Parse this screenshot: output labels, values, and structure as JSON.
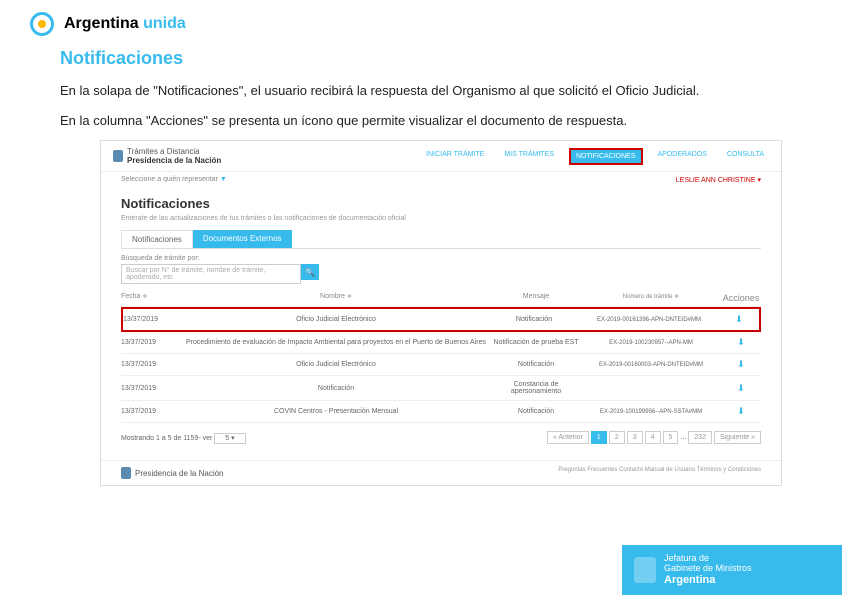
{
  "header": {
    "brand": "Argentina",
    "brand_suffix": "unida"
  },
  "section": {
    "title": "Notificaciones",
    "desc1": "En la solapa de \"Notificaciones\", el usuario recibirá la respuesta del Organismo al que solicitó el Oficio Judicial.",
    "desc2": "En la columna \"Acciones\" se presenta un ícono que permite visualizar el documento de respuesta."
  },
  "screenshot": {
    "brand_line1": "Trámites a Distancia",
    "brand_line2": "Presidencia de la Nación",
    "nav": [
      "INICIAR TRÁMITE",
      "MIS TRÁMITES",
      "NOTIFICACIONES",
      "APODERADOS",
      "CONSULTA"
    ],
    "userrow_left": "Seleccione a quién representar",
    "userrow_right": "LESLIE ANN CHRISTINE",
    "main_title": "Notificaciones",
    "main_sub": "Enterate de las actualizaciones de tus trámites o las notificaciones de documentación oficial",
    "tabs": [
      "Notificaciones",
      "Documentos Externos"
    ],
    "search_label": "Búsqueda de trámite por:",
    "search_placeholder": "Buscar por N° de trámite, nombre de trámite, apoderado, etc",
    "columns": [
      "Fecha",
      "Nombre",
      "Mensaje",
      "Número de trámite",
      "Acciones"
    ],
    "rows": [
      {
        "fecha": "13/37/2019",
        "nombre": "Oficio Judicial Electrónico",
        "mensaje": "Notificación",
        "tramite": "EX-2019-00161396-APN-DNTEID#MM",
        "highlight": true
      },
      {
        "fecha": "13/37/2019",
        "nombre": "Procedimiento de evaluación de Impacto Ambiental para proyectos en el Puerto de Buenos Aires",
        "mensaje": "Notificación de prueba EST",
        "tramite": "EX-2019-100230957--APN-MM",
        "highlight": false
      },
      {
        "fecha": "13/37/2019",
        "nombre": "Oficio Judicial Electrónico",
        "mensaje": "Notificación",
        "tramite": "EX-2019-00160003-APN-DNTEID#MM",
        "highlight": false
      },
      {
        "fecha": "13/37/2019",
        "nombre": "Notificación",
        "mensaje": "Constancia de apersonamiento",
        "tramite": "",
        "highlight": false
      },
      {
        "fecha": "13/37/2019",
        "nombre": "COVIN Centros - Presentación Mensual",
        "mensaje": "Notificación",
        "tramite": "EX-2019-100199956--APN-SSTA#MM",
        "highlight": false
      }
    ],
    "pagination": {
      "showing": "Mostrando 1 a 5 de 1159- ver",
      "per_page": "5",
      "prev": "« Anterior",
      "pages": [
        "1",
        "2",
        "3",
        "4",
        "5",
        "...",
        "232"
      ],
      "next": "Siguiente »"
    },
    "footer": {
      "brand": "Presidencia de la Nación",
      "links": "Preguntas Frecuentes  Contacto  Manual de Usuario  Términos y Condiciones"
    }
  },
  "page_footer": {
    "line1": "Jefatura de",
    "line2": "Gabinete de Ministros",
    "line3": "Argentina"
  }
}
